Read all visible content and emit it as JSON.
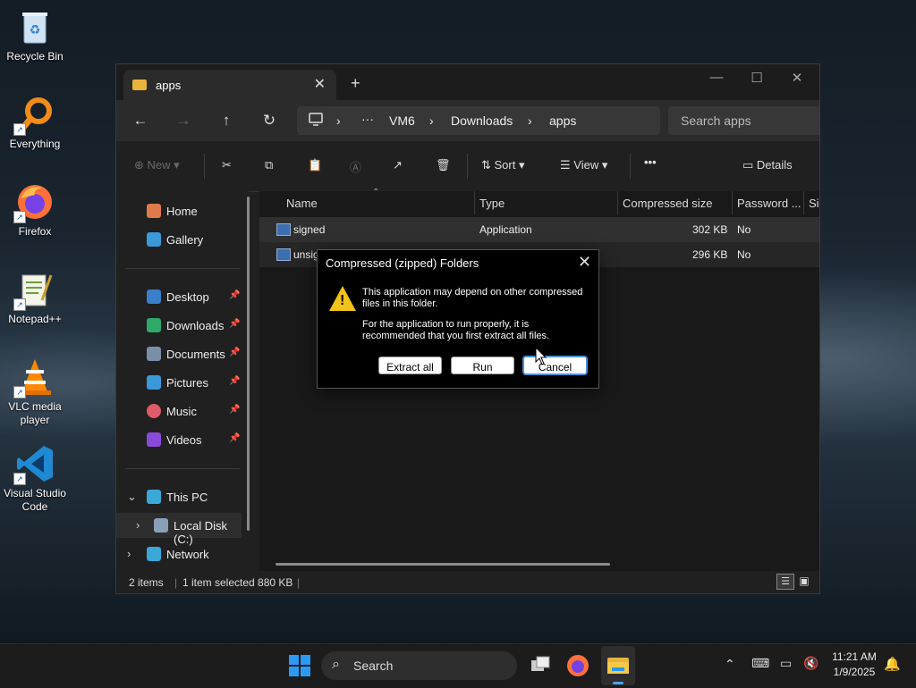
{
  "desktop": {
    "icons": [
      {
        "label": "Recycle Bin"
      },
      {
        "label": "Everything"
      },
      {
        "label": "Firefox"
      },
      {
        "label": "Notepad++"
      },
      {
        "label": "VLC media player"
      },
      {
        "label": "Visual Studio Code"
      }
    ]
  },
  "window": {
    "tab_title": "apps",
    "address": {
      "segments": [
        "VM6",
        "Downloads",
        "apps"
      ]
    },
    "search_placeholder": "Search apps",
    "toolbar": {
      "new": "New",
      "sort": "Sort",
      "view": "View",
      "more": "•••",
      "details": "Details"
    },
    "nav": {
      "home": "Home",
      "gallery": "Gallery",
      "quick": [
        "Desktop",
        "Downloads",
        "Documents",
        "Pictures",
        "Music",
        "Videos"
      ],
      "this_pc": "This PC",
      "local_disk": "Local Disk (C:)",
      "network": "Network"
    },
    "columns": [
      "Name",
      "Type",
      "Compressed size",
      "Password ...",
      "Si"
    ],
    "files": [
      {
        "name": "signed",
        "type": "Application",
        "size": "302 KB",
        "password": "No"
      },
      {
        "name": "unsig",
        "type": "",
        "size": "296 KB",
        "password": "No"
      }
    ],
    "status": {
      "count": "2 items",
      "selected": "1 item selected  880 KB"
    }
  },
  "dialog": {
    "title": "Compressed (zipped) Folders",
    "message1": "This application may depend on other compressed files in this folder.",
    "message2": "For the application to run properly, it is recommended that you first extract all files.",
    "buttons": {
      "extract": "Extract all",
      "run": "Run",
      "cancel": "Cancel"
    }
  },
  "taskbar": {
    "search": "Search",
    "time": "11:21 AM",
    "date": "1/9/2025"
  },
  "colors": {
    "accent": "#4a90d9",
    "warning": "#f2c318",
    "folder": "#e8b33b"
  }
}
